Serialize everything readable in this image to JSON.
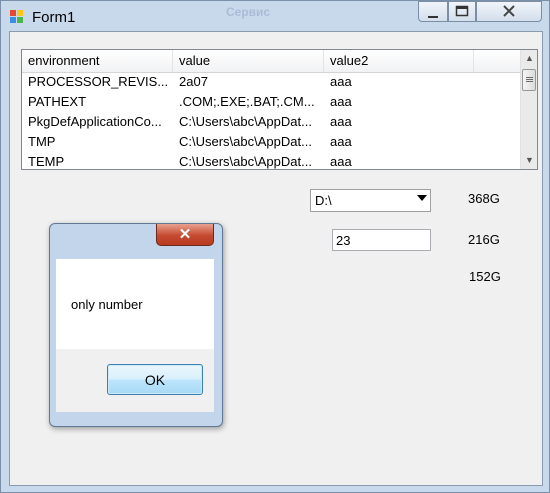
{
  "window": {
    "title": "Form1",
    "background_text": "Сервис"
  },
  "listview": {
    "columns": [
      "environment",
      "value",
      "value2",
      ""
    ],
    "rows": [
      [
        "PROCESSOR_REVIS...",
        "2a07",
        "aaa"
      ],
      [
        "PATHEXT",
        ".COM;.EXE;.BAT;.CM...",
        "aaa"
      ],
      [
        "PkgDefApplicationCo...",
        "C:\\Users\\abc\\AppDat...",
        "aaa"
      ],
      [
        "TMP",
        "C:\\Users\\abc\\AppDat...",
        "aaa"
      ],
      [
        "TEMP",
        "C:\\Users\\abc\\AppDat...",
        "aaa"
      ]
    ]
  },
  "drive_combo": {
    "value": "D:\\"
  },
  "number_box": {
    "value": "23"
  },
  "sizes": {
    "total": "368G",
    "used": "216G",
    "free": "152G"
  },
  "msgbox": {
    "text": "only number",
    "ok_label": "OK"
  },
  "colors": {
    "msgbox_close": "#c44a2f",
    "window_frame": "#c9d9ec"
  }
}
